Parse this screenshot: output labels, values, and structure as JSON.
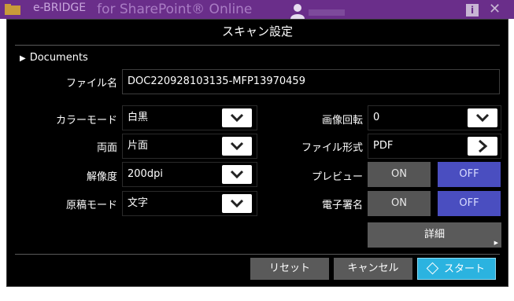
{
  "appbar": {
    "brand": "e-BRIDGE",
    "title": "for SharePoint® Online"
  },
  "dialog": {
    "title": "スキャン設定",
    "breadcrumb": "Documents"
  },
  "filename": {
    "label": "ファイル名",
    "value": "DOC220928103135-MFP13970459"
  },
  "left_settings": [
    {
      "label": "カラーモード",
      "value": "白黒"
    },
    {
      "label": "両面",
      "value": "片面"
    },
    {
      "label": "解像度",
      "value": "200dpi"
    },
    {
      "label": "原稿モード",
      "value": "文字"
    }
  ],
  "right_settings": {
    "rotation": {
      "label": "画像回転",
      "value": "0"
    },
    "format": {
      "label": "ファイル形式",
      "value": "PDF"
    },
    "preview": {
      "label": "プレビュー",
      "on": "ON",
      "off": "OFF",
      "selected": "OFF"
    },
    "signature": {
      "label": "電子署名",
      "on": "ON",
      "off": "OFF",
      "selected": "OFF"
    }
  },
  "detail_button": "詳細",
  "actions": {
    "reset": "リセット",
    "cancel": "キャンセル",
    "start": "スタート"
  },
  "colors": {
    "accent_selected": "#4a4ec0",
    "start": "#2bb3e0",
    "appbar": "#6a2e8a"
  }
}
